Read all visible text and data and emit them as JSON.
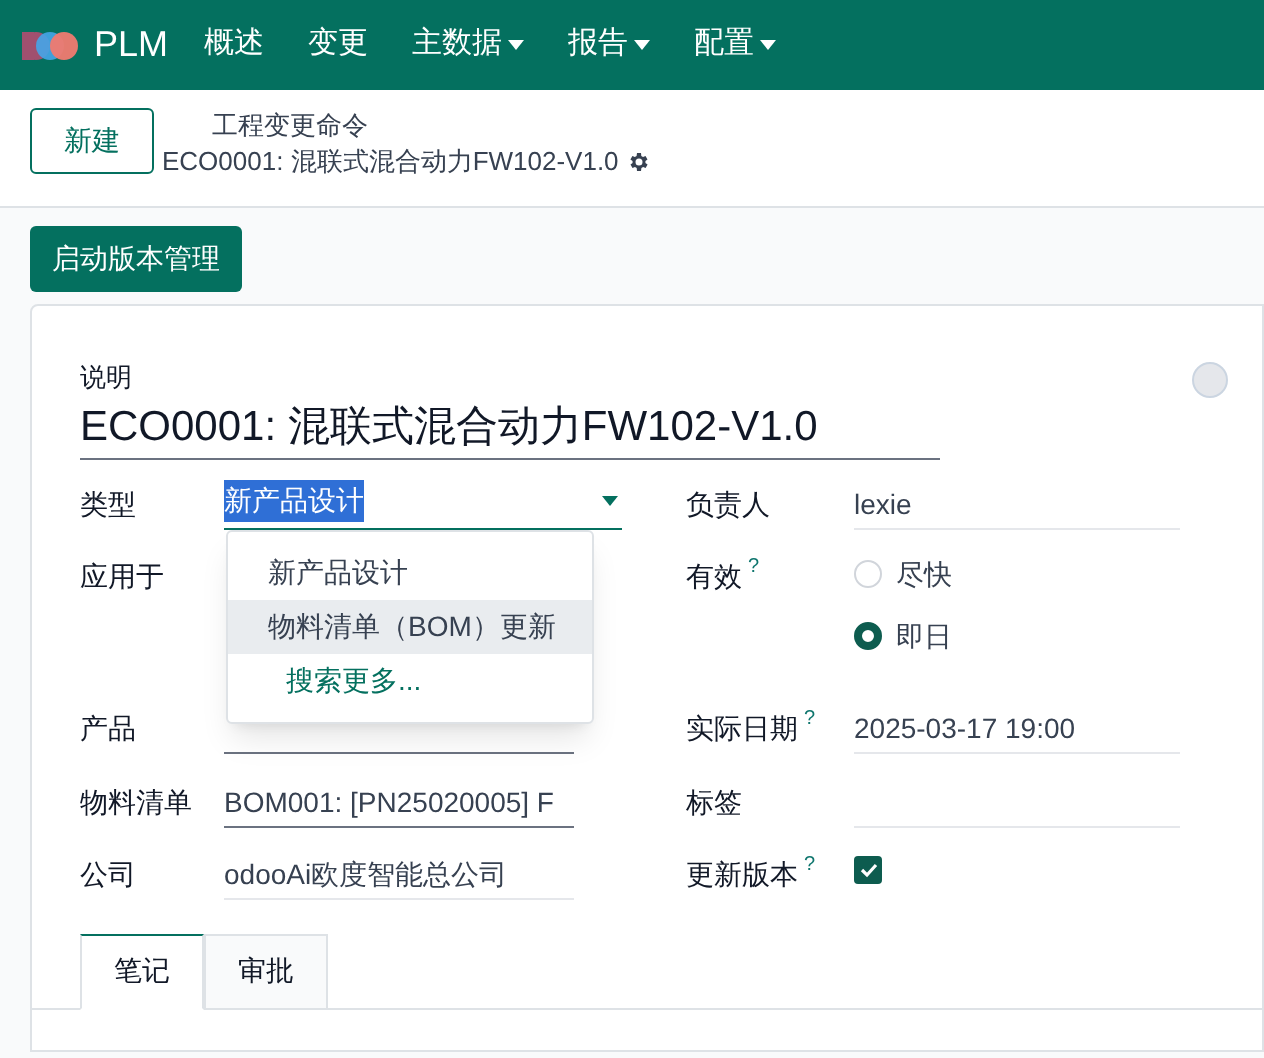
{
  "navbar": {
    "app": "PLM",
    "menus": [
      {
        "label": "概述",
        "dropdown": false
      },
      {
        "label": "变更",
        "dropdown": false
      },
      {
        "label": "主数据",
        "dropdown": true
      },
      {
        "label": "报告",
        "dropdown": true
      },
      {
        "label": "配置",
        "dropdown": true
      }
    ]
  },
  "control_panel": {
    "new_button": "新建",
    "breadcrumb": "工程变更命令",
    "record_title": "ECO0001: 混联式混合动力FW102-V1.0"
  },
  "action_button": "启动版本管理",
  "form": {
    "description_label": "说明",
    "title": "ECO0001: 混联式混合动力FW102-V1.0",
    "rows": [
      {
        "left": {
          "kind": "select",
          "label": "类型",
          "value": "新产品设计",
          "focused": true,
          "text_selected": true
        },
        "right": {
          "kind": "text",
          "label": "负责人",
          "value": "lexie"
        }
      },
      {
        "left": {
          "kind": "empty",
          "label": "应用于"
        },
        "right": {
          "kind": "radio",
          "label": "有效",
          "help": "?",
          "options": [
            {
              "label": "尽快",
              "selected": false
            },
            {
              "label": "即日",
              "selected": true
            }
          ]
        }
      },
      {
        "left": {
          "kind": "text",
          "label": "产品",
          "required": true
        },
        "right": {
          "kind": "text",
          "label": "实际日期",
          "value": "2025-03-17 19:00",
          "help": "?"
        }
      },
      {
        "left": {
          "kind": "text",
          "label": "物料清单",
          "value": "BOM001: [PN25020005] F",
          "required": true
        },
        "right": {
          "kind": "text",
          "label": "标签"
        }
      },
      {
        "left": {
          "kind": "text",
          "label": "公司",
          "value": "odooAi欧度智能总公司",
          "required": false
        },
        "right": {
          "kind": "checkbox",
          "label": "更新版本",
          "help": "?",
          "checked": true
        }
      }
    ],
    "dropdown": {
      "items": [
        {
          "label": "新产品设计",
          "hovered": false
        },
        {
          "label": "物料清单（BOM）更新",
          "hovered": true
        }
      ],
      "search_more": "搜索更多..."
    },
    "tabs": [
      {
        "label": "笔记",
        "selected": true
      },
      {
        "label": "审批",
        "selected": false
      }
    ]
  }
}
